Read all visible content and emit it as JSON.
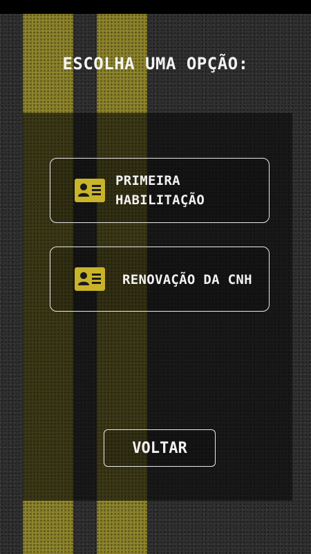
{
  "screen": {
    "title": "ESCOLHA UMA OPÇÃO:"
  },
  "options": [
    {
      "label_line1": "PRIMEIRA",
      "label_line2": "HABILITAÇÃO",
      "icon": "id-card-icon"
    },
    {
      "label_line1": "RENOVAÇÃO DA CNH",
      "label_line2": "",
      "icon": "id-card-icon"
    }
  ],
  "footer": {
    "back_label": "VOLTAR"
  },
  "colors": {
    "accent_yellow": "#c9b42a",
    "stripe_yellow": "#8a8126",
    "border": "#e9e9e9",
    "asphalt": "#2b2b2b"
  }
}
